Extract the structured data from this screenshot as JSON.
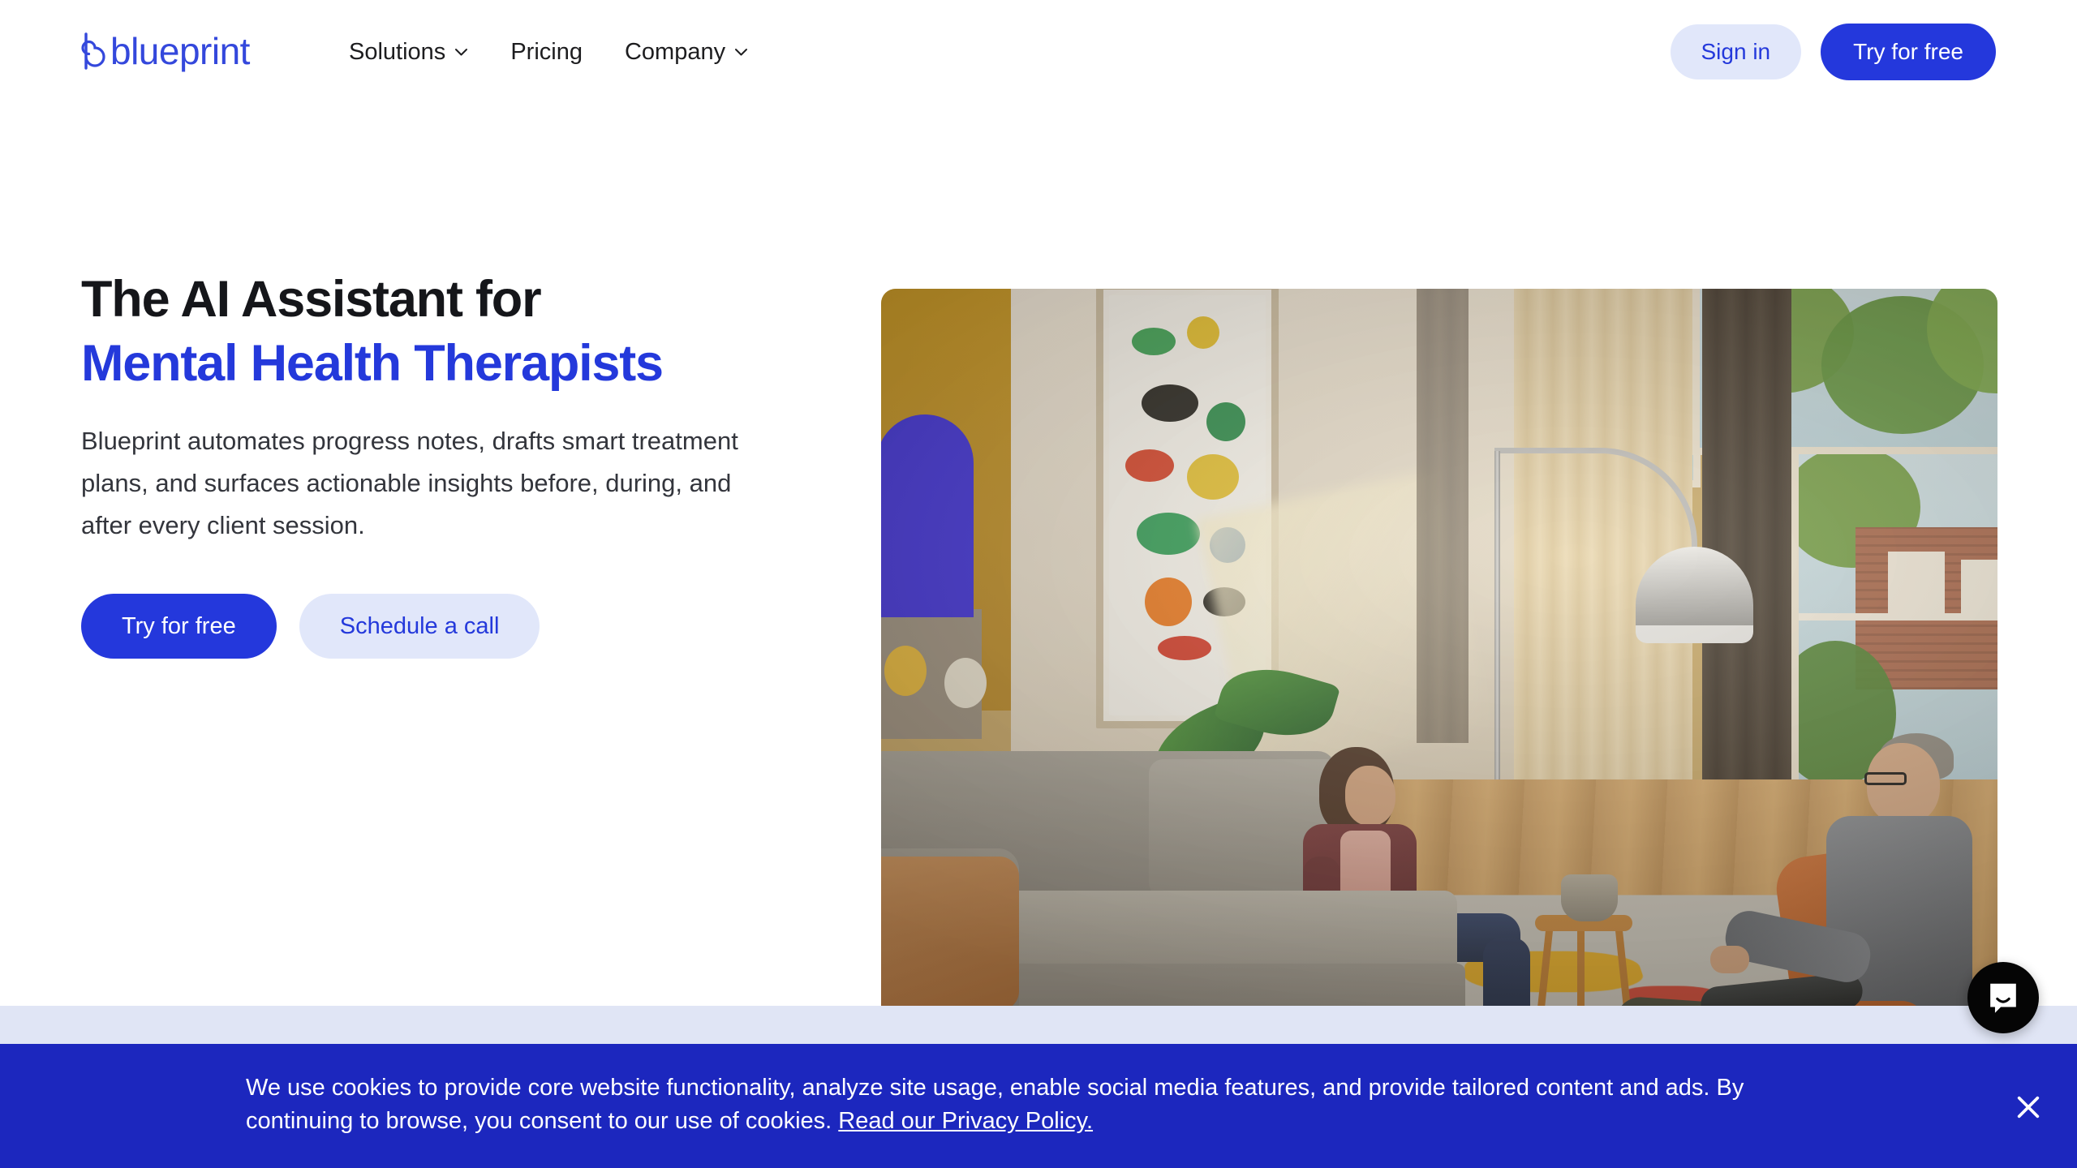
{
  "brand": {
    "name": "blueprint",
    "logo_icon": "blueprint-spiral-b-icon",
    "accent_blue": "#2438DC",
    "headline_blue": "#2439DB",
    "ghost_bg": "#E1E7FA",
    "banner_blue": "#1C27BE",
    "band_lavender": "#E0E5F5"
  },
  "nav": {
    "items": [
      {
        "label": "Solutions",
        "has_dropdown": true
      },
      {
        "label": "Pricing",
        "has_dropdown": false
      },
      {
        "label": "Company",
        "has_dropdown": true
      }
    ],
    "sign_in_label": "Sign in",
    "try_free_label": "Try for free"
  },
  "hero": {
    "headline_line1": "The AI Assistant for",
    "headline_line2": "Mental Health Therapists",
    "subtext": "Blueprint automates progress notes, drafts smart treatment plans, and surfaces actionable insights before, during, and after every client session.",
    "primary_cta": "Try for free",
    "secondary_cta": "Schedule a call",
    "image_alt": "therapy-session-living-room-photo"
  },
  "cookie_banner": {
    "text": "We use cookies to provide core website functionality, analyze site usage, enable social media features, and provide tailored content and ads. By continuing to browse, you consent to our use of cookies. ",
    "link_label": "Read our Privacy Policy.",
    "close_icon": "close-icon"
  },
  "chat_widget": {
    "icon": "chat-bubble-icon"
  }
}
